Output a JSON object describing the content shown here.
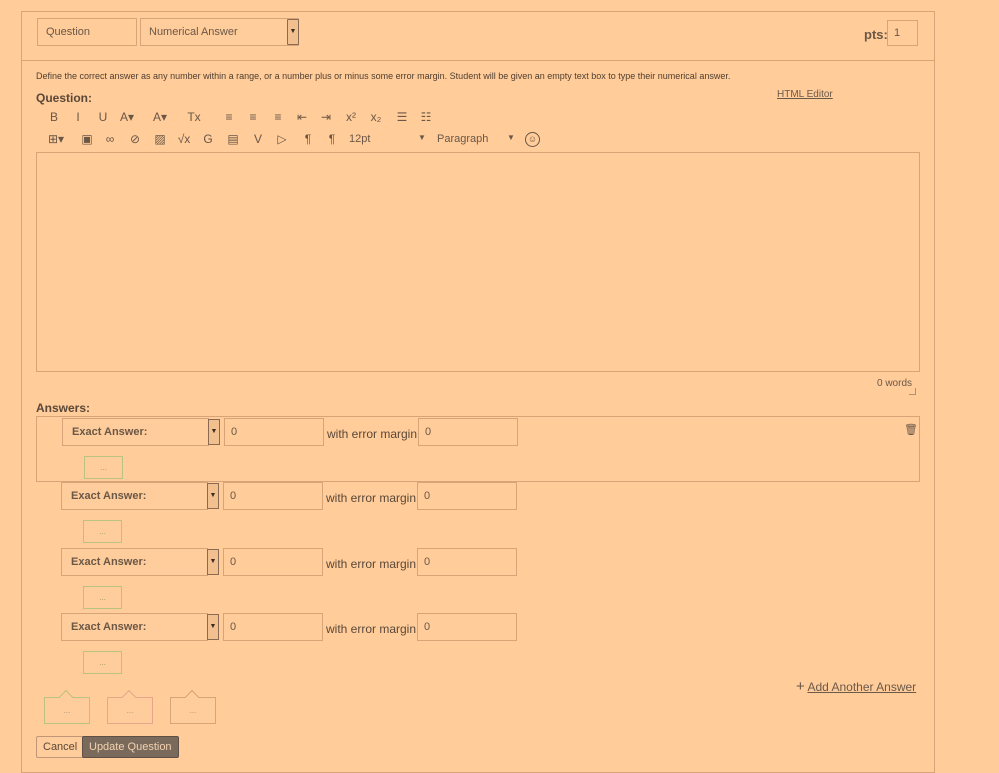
{
  "header": {
    "question_name_value": "Question",
    "question_type_selected": "Numerical Answer",
    "points_label": "pts:",
    "points_value": "1"
  },
  "description": "Define the correct answer as any number within a range, or a number plus or minus some error margin. Student will be given an empty text box to type their numerical answer.",
  "question_label": "Question:",
  "html_editor_link": "HTML Editor",
  "toolbar": {
    "row1": [
      {
        "name": "bold-icon",
        "glyph": "B"
      },
      {
        "name": "italic-icon",
        "glyph": "I"
      },
      {
        "name": "underline-icon",
        "glyph": "U"
      },
      {
        "name": "text-color-icon",
        "glyph": "A▾"
      },
      {
        "name": "background-color-icon",
        "glyph": "A▾"
      },
      {
        "name": "clear-formatting-icon",
        "glyph": "Tx"
      },
      {
        "name": "align-left-icon",
        "glyph": "≡"
      },
      {
        "name": "align-center-icon",
        "glyph": "≡"
      },
      {
        "name": "align-right-icon",
        "glyph": "≡"
      },
      {
        "name": "outdent-icon",
        "glyph": "⇤"
      },
      {
        "name": "indent-icon",
        "glyph": "⇥"
      },
      {
        "name": "superscript-icon",
        "glyph": "x²"
      },
      {
        "name": "subscript-icon",
        "glyph": "x₂"
      },
      {
        "name": "bullet-list-icon",
        "glyph": "☰"
      },
      {
        "name": "numbered-list-icon",
        "glyph": "☷"
      }
    ],
    "row2": [
      {
        "name": "table-icon",
        "glyph": "⊞▾"
      },
      {
        "name": "media-icon",
        "glyph": "▣"
      },
      {
        "name": "link-icon",
        "glyph": "∞"
      },
      {
        "name": "unlink-icon",
        "glyph": "⊘"
      },
      {
        "name": "image-icon",
        "glyph": "▨"
      },
      {
        "name": "math-equation-icon",
        "glyph": "√x"
      },
      {
        "name": "embed-icon",
        "glyph": "G"
      },
      {
        "name": "record-icon",
        "glyph": "▤"
      },
      {
        "name": "apps-icon",
        "glyph": "V"
      },
      {
        "name": "video-icon",
        "glyph": "▷"
      },
      {
        "name": "ltr-icon",
        "glyph": "¶"
      },
      {
        "name": "rtl-icon",
        "glyph": "¶"
      }
    ],
    "font_size": "12pt",
    "block_format": "Paragraph",
    "accessibility_icon": "accessibility-icon"
  },
  "word_count": "0 words",
  "answers_label": "Answers:",
  "answers": [
    {
      "type": "Exact Answer:",
      "value": "0",
      "margin_label": "with error margin",
      "margin": "0"
    },
    {
      "type": "Exact Answer:",
      "value": "0",
      "margin_label": "with error margin",
      "margin": "0"
    },
    {
      "type": "Exact Answer:",
      "value": "0",
      "margin_label": "with error margin",
      "margin": "0"
    },
    {
      "type": "Exact Answer:",
      "value": "0",
      "margin_label": "with error margin",
      "margin": "0"
    }
  ],
  "comment_placeholder": "...",
  "add_answer_label": "Add Another Answer",
  "feedback_placeholder": "...",
  "buttons": {
    "cancel": "Cancel",
    "update": "Update Question"
  },
  "colors": {
    "background": "#ffcc9a",
    "border": "#d7a477",
    "update_button": "#7a6a5c"
  }
}
